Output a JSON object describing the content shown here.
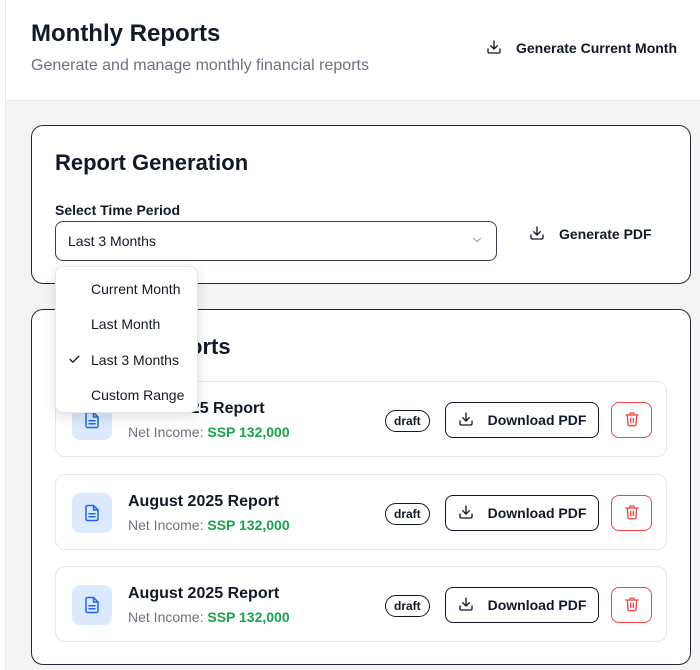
{
  "header": {
    "title": "Monthly Reports",
    "subtitle": "Generate and manage monthly financial reports",
    "generate_current_label": "Generate Current Month"
  },
  "generation": {
    "title": "Report Generation",
    "period_label": "Select Time Period",
    "selected_period": "Last 3 Months",
    "generate_pdf_label": "Generate PDF"
  },
  "dropdown": {
    "options": [
      "Current Month",
      "Last Month",
      "Last 3 Months",
      "Custom Range"
    ],
    "selected_index": 2
  },
  "reports": {
    "title": "Generated Reports",
    "visible_title_fragment": "orts",
    "income_label": "Net Income:",
    "download_label": "Download PDF",
    "items": [
      {
        "title": "August 2025 Report",
        "visible_title": "2025 Report",
        "amount": "SSP 132,000",
        "status": "draft"
      },
      {
        "title": "August 2025 Report",
        "amount": "SSP 132,000",
        "status": "draft"
      },
      {
        "title": "August 2025 Report",
        "amount": "SSP 132,000",
        "status": "draft"
      }
    ]
  },
  "colors": {
    "income_green": "#16a34a",
    "delete_red": "#ef4444",
    "doc_badge_bg": "#dbeafe",
    "doc_icon_blue": "#2563eb"
  },
  "icons": {
    "download": "download-icon",
    "document": "file-text-icon",
    "delete": "trash-icon",
    "chevron": "chevron-down-icon",
    "check": "check-icon"
  }
}
